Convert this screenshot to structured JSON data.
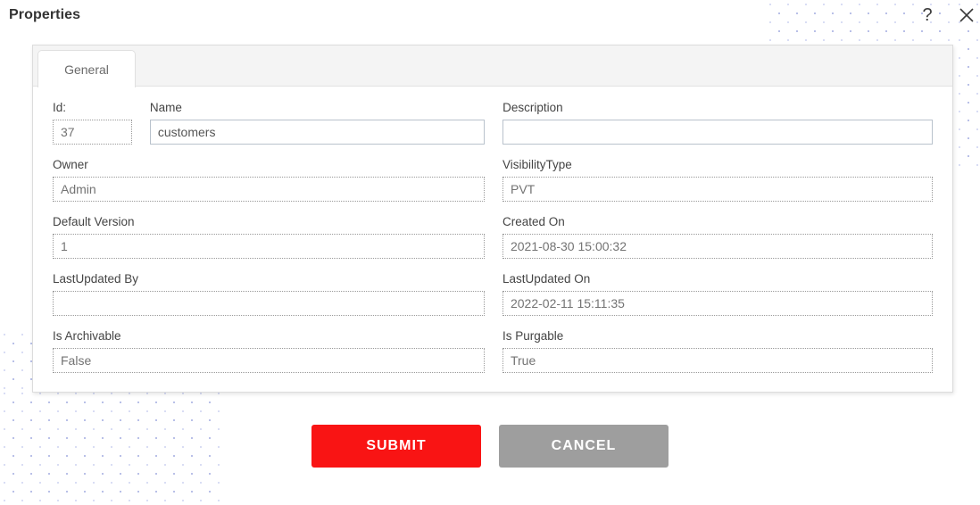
{
  "header": {
    "title": "Properties",
    "help_icon": "question-mark-icon",
    "close_icon": "close-x-icon"
  },
  "tabs": [
    {
      "label": "General",
      "active": true
    }
  ],
  "form": {
    "rows": [
      {
        "fields": [
          {
            "label": "Id:",
            "value": "37",
            "editable": false
          },
          {
            "label": "Name",
            "value": "customers",
            "editable": true
          },
          {
            "label": "Description",
            "value": "",
            "editable": true
          }
        ]
      },
      {
        "fields": [
          {
            "label": "Owner",
            "value": "Admin",
            "editable": false
          },
          {
            "label": "VisibilityType",
            "value": "PVT",
            "editable": false
          }
        ]
      },
      {
        "fields": [
          {
            "label": "Default Version",
            "value": "1",
            "editable": false
          },
          {
            "label": "Created On",
            "value": "2021-08-30 15:00:32",
            "editable": false
          }
        ]
      },
      {
        "fields": [
          {
            "label": "LastUpdated By",
            "value": "",
            "editable": false
          },
          {
            "label": "LastUpdated On",
            "value": "2022-02-11 15:11:35",
            "editable": false
          }
        ]
      },
      {
        "fields": [
          {
            "label": "Is Archivable",
            "value": "False",
            "editable": false
          },
          {
            "label": "Is Purgable",
            "value": "True",
            "editable": false
          }
        ]
      }
    ]
  },
  "buttons": {
    "submit_label": "SUBMIT",
    "cancel_label": "CANCEL"
  },
  "colors": {
    "submit_red": "#f91414",
    "cancel_gray": "#9e9e9e",
    "panel_border": "#dcdcdc",
    "tab_bar_bg": "#f4f4f4",
    "dot_pattern": "#b9c0e8"
  }
}
